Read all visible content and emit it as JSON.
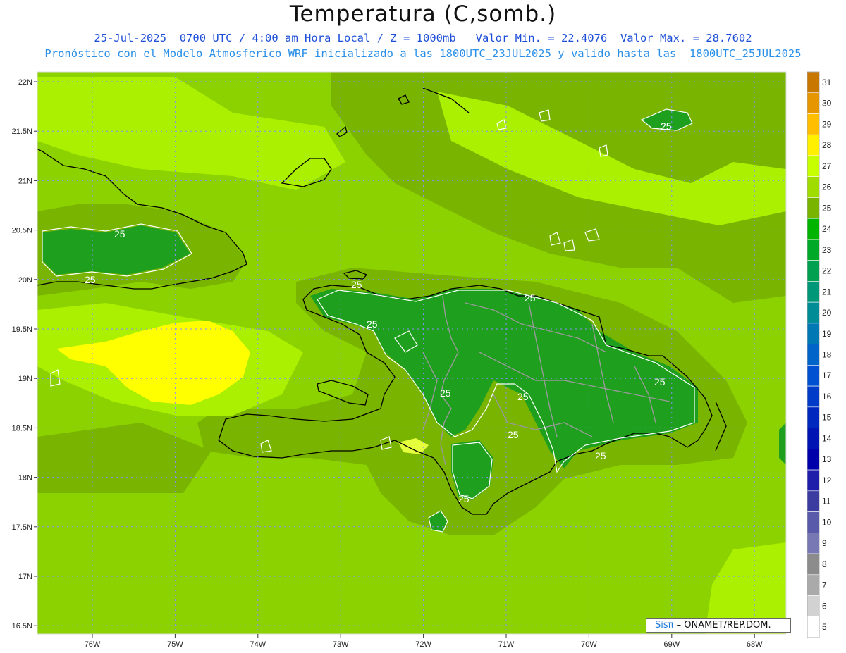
{
  "header": {
    "title": "Temperatura (C,somb.)",
    "line1": "25-Jul-2025  0700 UTC / 4:00 am Hora Local / Z = 1000mb   Valor Min. = 22.4076  Valor Max. = 28.7602",
    "line2": "Pronóstico con el Modelo Atmosferico WRF inicializado a las 1800UTC_23JUL2025 y valido hasta las  1800UTC_25JUL2025"
  },
  "axes": {
    "lat_labels": [
      "22N",
      "21.5N",
      "21N",
      "20.5N",
      "20N",
      "19.5N",
      "19N",
      "18.5N",
      "18N",
      "17.5N",
      "17N",
      "16.5N"
    ],
    "lon_labels": [
      "76W",
      "75W",
      "74W",
      "73W",
      "72W",
      "71W",
      "70W",
      "69W",
      "68W"
    ]
  },
  "contour_labels": [
    "25",
    "25",
    "25",
    "25",
    "25",
    "25",
    "25",
    "25",
    "25",
    "25",
    "25",
    "25",
    "25"
  ],
  "colorbar": {
    "labels": [
      "31",
      "30",
      "29",
      "28",
      "27",
      "26",
      "25",
      "24",
      "23",
      "22",
      "21",
      "20",
      "19",
      "18",
      "17",
      "16",
      "15",
      "14",
      "13",
      "12",
      "11",
      "10",
      "9",
      "8",
      "7",
      "6",
      "5"
    ],
    "colors": [
      "#c87800",
      "#e59600",
      "#ffbe00",
      "#fff000",
      "#c8ff00",
      "#a0dc00",
      "#78b400",
      "#00b400",
      "#00aa28",
      "#00a050",
      "#009678",
      "#008c96",
      "#0078b4",
      "#0064c8",
      "#0050d2",
      "#003cc8",
      "#0028be",
      "#0014b4",
      "#0000aa",
      "#1e1eaa",
      "#3c3ca0",
      "#5a5aaa",
      "#7878b4",
      "#8c8c8c",
      "#aaaaaa",
      "#d2d2d2",
      "#ffffff"
    ]
  },
  "credit": {
    "logo": "Sisπ",
    "text": " – ONAMET/REP.DOM."
  },
  "colors": {
    "sea": "#8cd200",
    "band_light": "#aaf000",
    "band_mid": "#78b400",
    "land_dark": "#1ea01e",
    "warm": "#ffff00",
    "coast": "#000000",
    "border": "#999999",
    "contour": "#ffffff"
  }
}
